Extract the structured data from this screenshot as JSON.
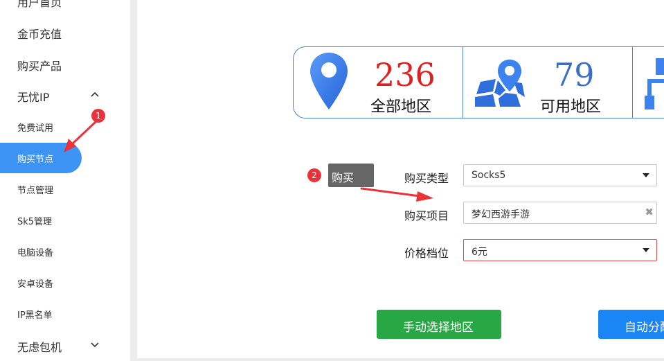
{
  "sidebar": {
    "items": [
      {
        "label": "用户首页"
      },
      {
        "label": "金币充值"
      },
      {
        "label": "购买产品"
      },
      {
        "label": "无忧IP"
      },
      {
        "label": "免费试用"
      },
      {
        "label": "购买节点"
      },
      {
        "label": "节点管理"
      },
      {
        "label": "Sk5管理"
      },
      {
        "label": "电脑设备"
      },
      {
        "label": "安卓设备"
      },
      {
        "label": "IP黑名单"
      },
      {
        "label": "无虑包机"
      }
    ]
  },
  "stats": {
    "all": {
      "value": "236",
      "label": "全部地区",
      "color": "#e02020"
    },
    "available": {
      "value": "79",
      "label": "可用地区",
      "color": "#3b6fc4"
    }
  },
  "form": {
    "type_label": "购买类型",
    "type_value": "Socks5",
    "project_label": "购买项目",
    "project_value": "梦幻西游手游",
    "clear_glyph": "✖",
    "price_label": "价格档位",
    "price_value": "6元"
  },
  "tooltip": {
    "text": "购买"
  },
  "annotations": {
    "badge1": "1",
    "badge2": "2"
  },
  "buttons": {
    "manual": "手动选择地区",
    "auto": "自动分配"
  },
  "colors": {
    "accent": "#3e94f5",
    "green": "#28a745",
    "blue": "#1a86f5",
    "annotation_red": "#e8333a"
  }
}
